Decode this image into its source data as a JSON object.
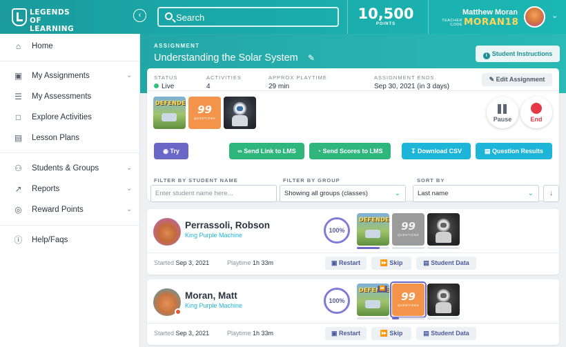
{
  "header": {
    "logo_text": "LEGENDS OF LEARNING",
    "collapse_icon": "chevron-left-icon",
    "search_placeholder": "Search",
    "points_value": "10,500",
    "points_label": "POINTS",
    "user_name": "Matthew Moran",
    "teacher_code_label": "TEACHER CODE",
    "teacher_code": "MORAN18"
  },
  "sidebar": {
    "items": [
      {
        "label": "Home",
        "icon": "home-icon"
      },
      {
        "label": "My Assignments",
        "icon": "clipboard-icon"
      },
      {
        "label": "My Assessments",
        "icon": "list-icon"
      },
      {
        "label": "Explore Activities",
        "icon": "folder-icon"
      },
      {
        "label": "Lesson Plans",
        "icon": "document-icon"
      },
      {
        "label": "Students & Groups",
        "icon": "users-icon"
      },
      {
        "label": "Reports",
        "icon": "chart-icon"
      },
      {
        "label": "Reward Points",
        "icon": "reward-icon"
      },
      {
        "label": "Help/Faqs",
        "icon": "help-icon"
      }
    ]
  },
  "assignment": {
    "label": "ASSIGNMENT",
    "title": "Understanding the Solar System",
    "instructions_button": "Student Instructions",
    "status_label": "STATUS",
    "status_value": "Live",
    "activities_label": "ACTIVITIES",
    "activities_value": "4",
    "playtime_label": "APPROX PLAYTIME",
    "playtime_value": "29 min",
    "ends_label": "ASSIGNMENT ENDS",
    "ends_value": "Sep 30, 2021 (in 3 days)",
    "edit_button": "Edit Assignment",
    "pause_label": "Pause",
    "end_label": "End",
    "try_button": "Try",
    "send_lms_button": "Send Link to LMS",
    "send_scores_button": "Send Scores to LMS",
    "download_csv_button": "Download CSV",
    "question_results_button": "Question Results"
  },
  "thumbnails": {
    "defender_title": "DEFENDER",
    "q99_number": "99",
    "q99_label": "QUESTIONS"
  },
  "filters": {
    "student_label": "FILTER BY STUDENT NAME",
    "student_placeholder": "Enter student name here...",
    "group_label": "FILTER BY GROUP",
    "group_value": "Showing all groups (classes)",
    "sort_label": "SORT BY",
    "sort_value": "Last name"
  },
  "students": [
    {
      "name": "Perrassoli, Robson",
      "team": "King Purple Machine",
      "progress": "100%",
      "started_label": "Started",
      "started": "Sep 3, 2021",
      "playtime_label": "Playtime",
      "playtime": "1h 33m",
      "restart": "Restart",
      "skip": "Skip",
      "student_data": "Student Data"
    },
    {
      "name": "Moran, Matt",
      "team": "King Purple Machine",
      "progress": "100%",
      "started_label": "Started",
      "started": "Sep 3, 2021",
      "playtime_label": "Playtime",
      "playtime": "1h 33m",
      "restart": "Restart",
      "skip": "Skip",
      "student_data": "Student Data"
    }
  ],
  "colors": {
    "teal": "#1aa6a6",
    "purple": "#6a67c9",
    "green": "#2fb67c",
    "cyan": "#1db6d8",
    "end_red": "#e63946"
  }
}
